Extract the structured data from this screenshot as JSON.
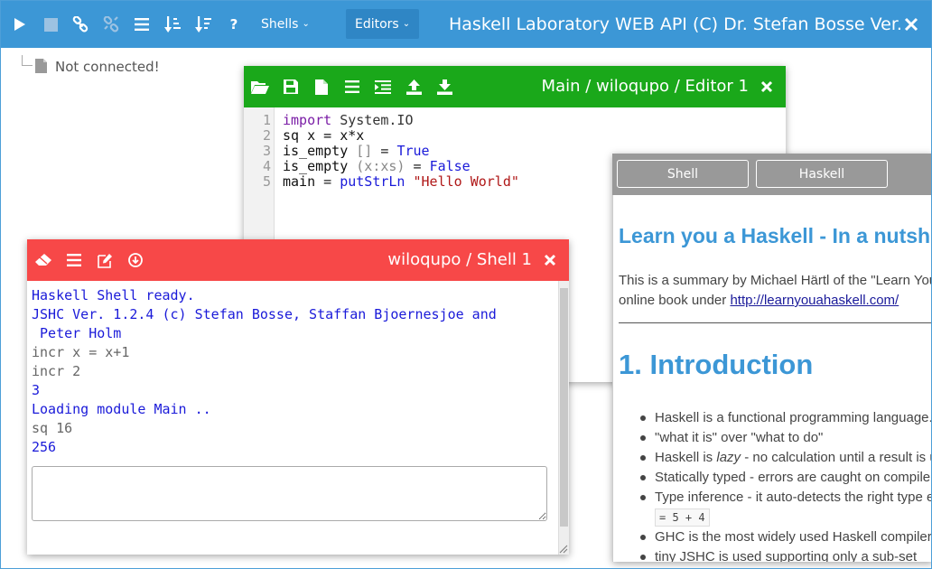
{
  "topbar": {
    "shells_menu": "Shells",
    "editors_menu": "Editors",
    "title": "Haskell Laboratory WEB API (C) Dr. Stefan Bosse Ver."
  },
  "tree": {
    "status": "Not connected!"
  },
  "editor": {
    "title": "Main / wiloqupo / Editor 1",
    "line_numbers": [
      "1",
      "2",
      "3",
      "4",
      "5"
    ],
    "lines": [
      [
        {
          "t": "import ",
          "c": "kw"
        },
        {
          "t": "System.IO",
          "c": "fn"
        }
      ],
      [
        {
          "t": "sq x = x*x",
          "c": "var"
        }
      ],
      [
        {
          "t": "is_empty ",
          "c": "var"
        },
        {
          "t": "[]",
          "c": "br"
        },
        {
          "t": " = ",
          "c": "op"
        },
        {
          "t": "True",
          "c": "tr"
        }
      ],
      [
        {
          "t": "is_empty ",
          "c": "var"
        },
        {
          "t": "(x:xs)",
          "c": "br"
        },
        {
          "t": " = ",
          "c": "op"
        },
        {
          "t": "False",
          "c": "tr"
        }
      ],
      [
        {
          "t": "main",
          "c": "var"
        },
        {
          "t": " = ",
          "c": "op"
        },
        {
          "t": "putStrLn",
          "c": "tr"
        },
        {
          "t": " ",
          "c": "op"
        },
        {
          "t": "\"Hello World\"",
          "c": "str"
        }
      ]
    ]
  },
  "shell": {
    "title": "wiloqupo / Shell 1",
    "output": [
      {
        "t": "Haskell Shell ready.",
        "c": "blue"
      },
      {
        "t": "JSHC Ver. 1.2.4 (c) Stefan Bosse, Staffan Bjoernesjoe and",
        "c": "blue"
      },
      {
        "t": " Peter Holm",
        "c": "blue"
      },
      {
        "t": "incr x = x+1",
        "c": "gray"
      },
      {
        "t": "incr 2",
        "c": "gray"
      },
      {
        "t": "3",
        "c": "blue"
      },
      {
        "t": "Loading module Main ..",
        "c": "blue"
      },
      {
        "t": "sq 16",
        "c": "gray"
      },
      {
        "t": "256",
        "c": "blue"
      }
    ],
    "input_value": ""
  },
  "doc": {
    "tabs": [
      "Shell",
      "Haskell"
    ],
    "heading": "Learn you a Haskell - In a nutshell",
    "intro_line1": "This is a summary by Michael Härtl of the \"Learn You a Haskell for Great Good!\"",
    "intro_line2_prefix": "online book under ",
    "intro_link": "http://learnyouahaskell.com/",
    "section_title": "1. Introduction",
    "bullets": [
      {
        "text": "Haskell is a functional programming language."
      },
      {
        "text": "\"what it is\" over \"what to do\""
      },
      {
        "pre": "Haskell is ",
        "em": "lazy",
        "post": " - no calculation until a result is used"
      },
      {
        "text": "Statically typed - errors are caught on compile time"
      },
      {
        "text": "Type inference - it auto-detects the right type e.g. for a"
      },
      {
        "code": "= 5 + 4"
      },
      {
        "text": "GHC is the most widely used Haskell compiler, here a"
      },
      {
        "text": "tiny JSHC is used supporting only a sub-set"
      }
    ]
  }
}
